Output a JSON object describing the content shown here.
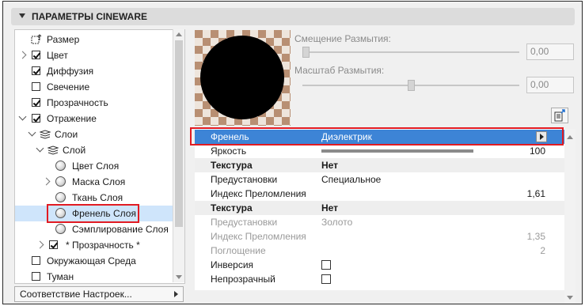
{
  "panel": {
    "title": "ПАРАМЕТРЫ CINEWARE"
  },
  "tree": {
    "items": [
      {
        "label": "Размер"
      },
      {
        "label": "Цвет"
      },
      {
        "label": "Диффузия"
      },
      {
        "label": "Свечение"
      },
      {
        "label": "Прозрачность"
      },
      {
        "label": "Отражение"
      },
      {
        "label": "Слои"
      },
      {
        "label": "Слой"
      },
      {
        "label": "Цвет Слоя"
      },
      {
        "label": "Маска Слоя"
      },
      {
        "label": "Ткань Слоя"
      },
      {
        "label": "Френель Слоя"
      },
      {
        "label": "Сэмплирование Слоя"
      },
      {
        "label": "* Прозрачность *"
      },
      {
        "label": "Окружающая Среда"
      },
      {
        "label": "Туман"
      }
    ]
  },
  "footer": {
    "match_button": "Соответствие Настроек..."
  },
  "blur": {
    "offset_label": "Смещение Размытия:",
    "offset_value": "0,00",
    "offset_slider": 0,
    "scale_label": "Масштаб Размытия:",
    "scale_value": "0,00",
    "scale_slider": 0.5
  },
  "props": {
    "rows": [
      {
        "name": "Френель",
        "value": "Диэлектрик",
        "num": ""
      },
      {
        "name": "Яркость",
        "value": "",
        "num": "100",
        "level": 1.0
      },
      {
        "name": "Текстура",
        "value": "Нет",
        "num": ""
      },
      {
        "name": "Предустановки",
        "value": "Специальное",
        "num": ""
      },
      {
        "name": "Индекс Преломления",
        "value": "",
        "num": "1,61"
      },
      {
        "name": "Текстура",
        "value": "Нет",
        "num": ""
      },
      {
        "name": "Предустановки",
        "value": "Золото",
        "num": ""
      },
      {
        "name": "Индекс Преломления",
        "value": "",
        "num": "1,35"
      },
      {
        "name": "Поглощение",
        "value": "",
        "num": "2"
      },
      {
        "name": "Инверсия",
        "value": "",
        "num": ""
      },
      {
        "name": "Непрозрачный",
        "value": "",
        "num": ""
      }
    ]
  },
  "colors": {
    "selection": "#3d84d6",
    "highlight_box": "#e11b22",
    "tree_selected": "#cfe5fb"
  }
}
